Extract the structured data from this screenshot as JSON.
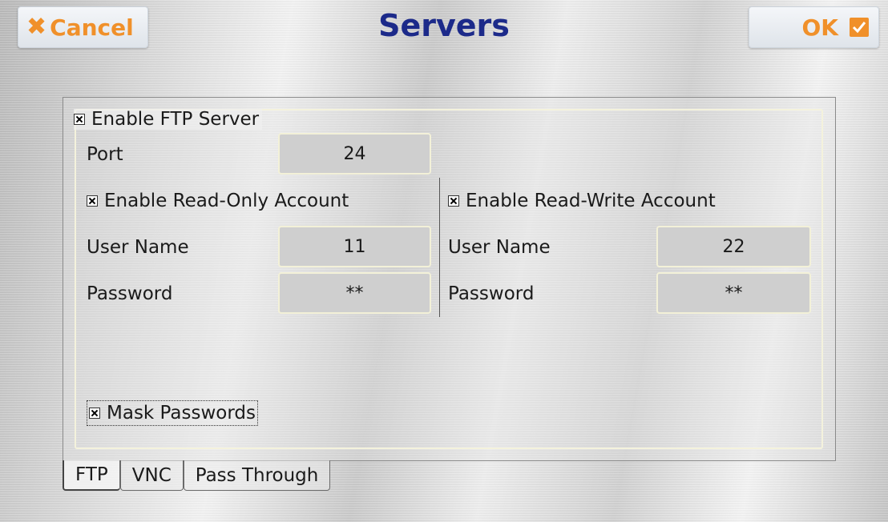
{
  "header": {
    "cancel_label": "Cancel",
    "title": "Servers",
    "ok_label": "OK"
  },
  "ftp": {
    "enable_label": "Enable FTP Server",
    "enabled": true,
    "port_label": "Port",
    "port_value": "24",
    "readonly": {
      "enable_label": "Enable Read-Only Account",
      "enabled": true,
      "username_label": "User Name",
      "username_value": "11",
      "password_label": "Password",
      "password_value": "**"
    },
    "readwrite": {
      "enable_label": "Enable Read-Write Account",
      "enabled": true,
      "username_label": "User Name",
      "username_value": "22",
      "password_label": "Password",
      "password_value": "**"
    },
    "mask_label": "Mask Passwords",
    "mask_enabled": true
  },
  "tabs": [
    "FTP",
    "VNC",
    "Pass Through"
  ],
  "active_tab": "FTP",
  "colors": {
    "accent": "#f0902a",
    "title": "#1c2a8a"
  },
  "icons": {
    "cancel": "close-icon",
    "ok": "checkbox-check-icon"
  }
}
